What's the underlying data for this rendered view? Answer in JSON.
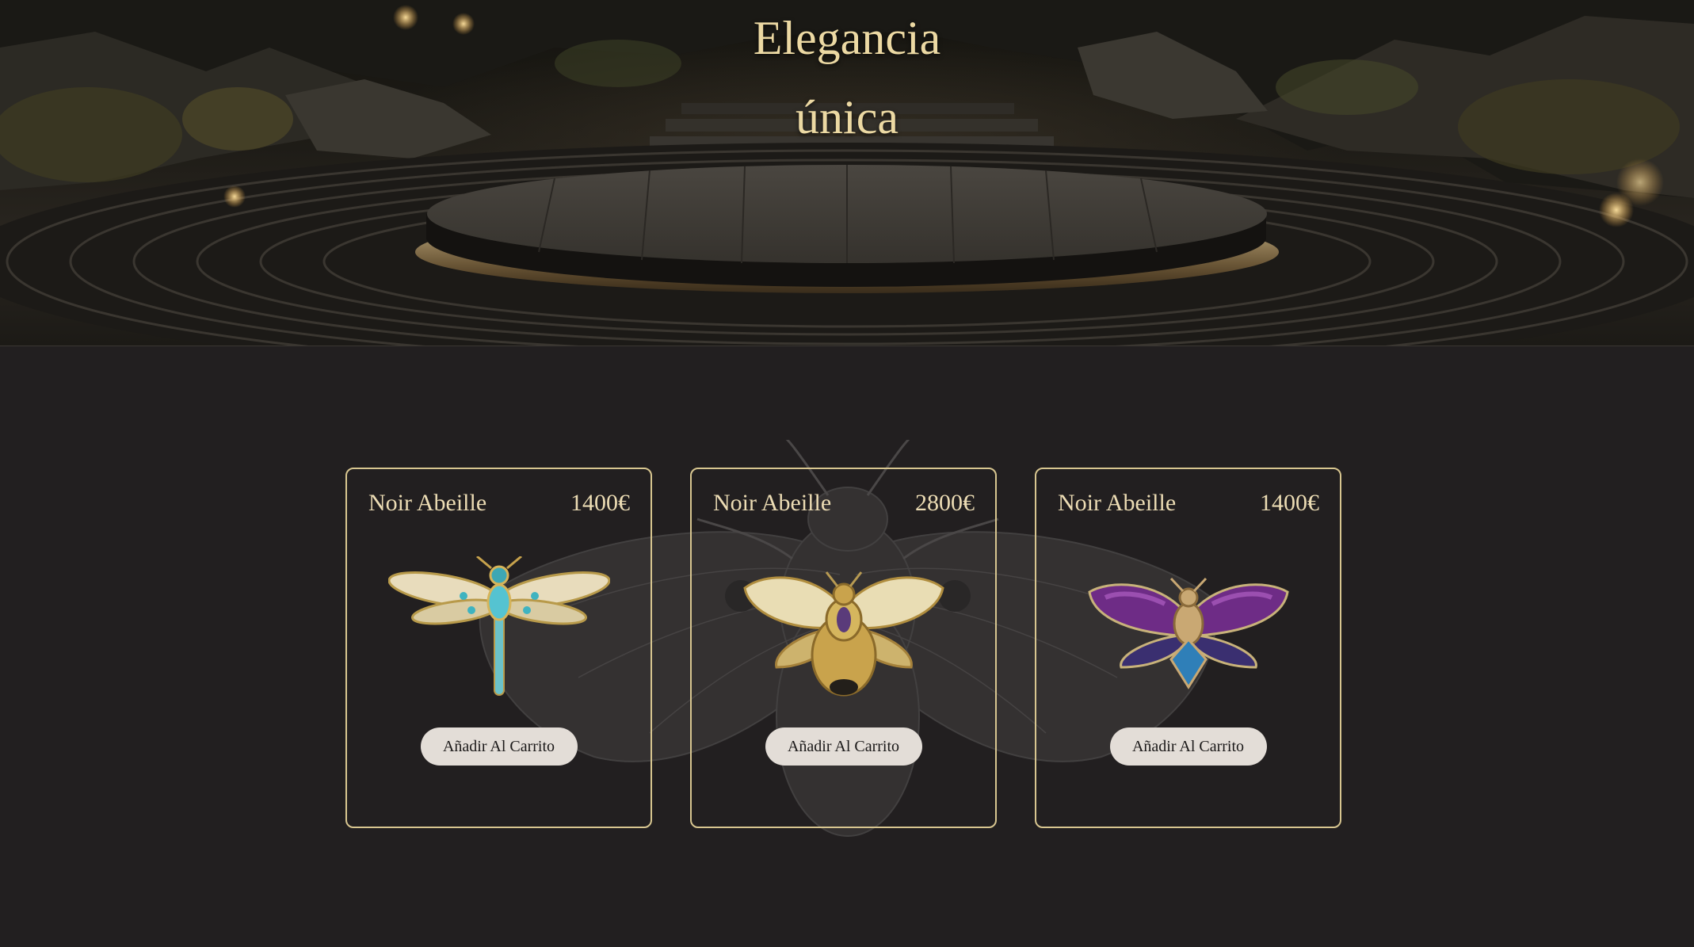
{
  "hero": {
    "title_line1": "Elegancia",
    "title_line2": "única"
  },
  "products": [
    {
      "name": "Noir Abeille",
      "price": "1400€",
      "button_label": "Añadir Al Carrito",
      "image": "dragonfly-brooch-icon"
    },
    {
      "name": "Noir Abeille",
      "price": "2800€",
      "button_label": "Añadir Al Carrito",
      "image": "bee-brooch-icon"
    },
    {
      "name": "Noir Abeille",
      "price": "1400€",
      "button_label": "Añadir Al Carrito",
      "image": "moth-brooch-icon"
    }
  ],
  "colors": {
    "background": "#221f20",
    "accent_gold": "#d8c690",
    "text_gold": "#ecdcb4",
    "button_bg": "#e3ddd7"
  }
}
